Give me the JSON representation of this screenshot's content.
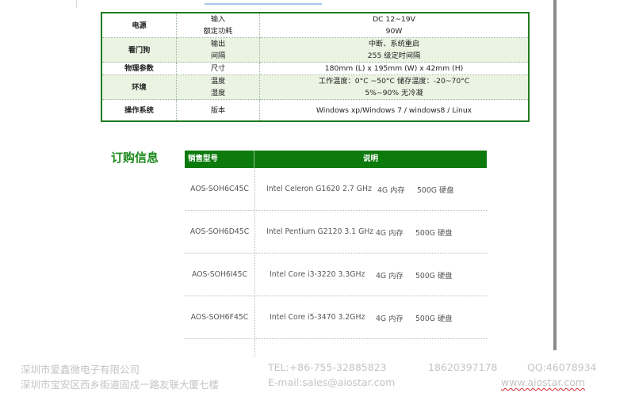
{
  "spec_table": {
    "rows": [
      {
        "cat": "电源",
        "subs": [
          "输入",
          "额定功耗"
        ],
        "vals": [
          "DC   12~19V",
          "90W"
        ],
        "alt": false
      },
      {
        "cat": "看门狗",
        "subs": [
          "输出",
          "间隔"
        ],
        "vals": [
          "中断、系统重启",
          "255 级定时间隔"
        ],
        "alt": true
      },
      {
        "cat": "物理参数",
        "subs": [
          "尺寸"
        ],
        "vals": [
          "180mm (L) x 195mm (W) x 42mm (H)"
        ],
        "alt": false
      },
      {
        "cat": "环境",
        "subs": [
          "温度",
          "湿度"
        ],
        "vals": [
          "工作温度：0°C ~50°C     储存温度：-20~70°C",
          "5%~90%  无冷凝"
        ],
        "alt": true
      },
      {
        "cat": "操作系统",
        "subs": [
          "版本"
        ],
        "vals": [
          "Windows xp/Windows 7 / windows8 / Linux"
        ],
        "alt": false
      }
    ]
  },
  "order_section": {
    "title": "订购信息",
    "headers": {
      "model": "销售型号",
      "desc": "说明"
    },
    "rows": [
      {
        "model": "AOS-SOH6C45C",
        "cpu": "Intel Celeron G1620 2.7 GHz",
        "mem": "4G 内存",
        "disk": "500G 硬盘"
      },
      {
        "model": "AOS-SOH6D45C",
        "cpu": "Intel Pentium G2120 3.1 GHz",
        "mem": "4G 内存",
        "disk": "500G 硬盘"
      },
      {
        "model": "AOS-SOH6I45C",
        "cpu": "Intel Core i3-3220    3.3GHz",
        "mem": "4G 内存",
        "disk": "500G 硬盘"
      },
      {
        "model": "AOS-SOH6F45C",
        "cpu": "Intel Core i5-3470    3.2GHz",
        "mem": "4G 内存",
        "disk": "500G 硬盘"
      }
    ]
  },
  "footer": {
    "company": "深圳市爱鑫微电子有限公司",
    "address": "深圳市宝安区西乡街道固戍一路友联大厦七楼",
    "tel": "TEL:+86-755-32885823",
    "email": "E-mail:sales@aiostar.com",
    "mobile": "18620397178",
    "qq": "QQ:46078934",
    "website": "www.aiostar.com"
  }
}
